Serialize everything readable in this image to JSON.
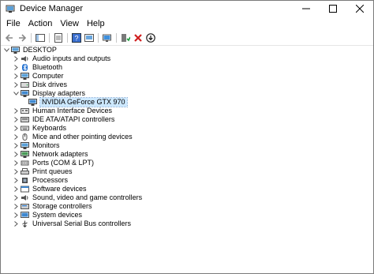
{
  "window": {
    "title": "Device Manager"
  },
  "menu": [
    "File",
    "Action",
    "View",
    "Help"
  ],
  "toolbar_icons": [
    "back-icon",
    "forward-icon",
    "show-hide-icon",
    "properties-icon",
    "help-icon",
    "update-driver-icon",
    "scan-icon",
    "enable-device-icon",
    "uninstall-icon",
    "download-icon"
  ],
  "tree": {
    "root": "DESKTOP",
    "categories": [
      {
        "label": "Audio inputs and outputs",
        "icon": "speaker-icon",
        "expanded": false
      },
      {
        "label": "Bluetooth",
        "icon": "bluetooth-icon",
        "expanded": false
      },
      {
        "label": "Computer",
        "icon": "computer-icon",
        "expanded": false
      },
      {
        "label": "Disk drives",
        "icon": "disk-icon",
        "expanded": false
      },
      {
        "label": "Display adapters",
        "icon": "display-adapter-icon",
        "expanded": true,
        "children": [
          {
            "label": "NVIDIA GeForce GTX 970",
            "icon": "display-adapter-icon",
            "selected": true
          }
        ]
      },
      {
        "label": "Human Interface Devices",
        "icon": "hid-icon",
        "expanded": false
      },
      {
        "label": "IDE ATA/ATAPI controllers",
        "icon": "ide-icon",
        "expanded": false
      },
      {
        "label": "Keyboards",
        "icon": "keyboard-icon",
        "expanded": false
      },
      {
        "label": "Mice and other pointing devices",
        "icon": "mouse-icon",
        "expanded": false
      },
      {
        "label": "Monitors",
        "icon": "monitor-icon",
        "expanded": false
      },
      {
        "label": "Network adapters",
        "icon": "network-icon",
        "expanded": false
      },
      {
        "label": "Ports (COM & LPT)",
        "icon": "port-icon",
        "expanded": false
      },
      {
        "label": "Print queues",
        "icon": "printer-icon",
        "expanded": false
      },
      {
        "label": "Processors",
        "icon": "processor-icon",
        "expanded": false
      },
      {
        "label": "Software devices",
        "icon": "software-device-icon",
        "expanded": false
      },
      {
        "label": "Sound, video and game controllers",
        "icon": "sound-icon",
        "expanded": false
      },
      {
        "label": "Storage controllers",
        "icon": "storage-icon",
        "expanded": false
      },
      {
        "label": "System devices",
        "icon": "system-icon",
        "expanded": false
      },
      {
        "label": "Universal Serial Bus controllers",
        "icon": "usb-icon",
        "expanded": false
      }
    ]
  }
}
